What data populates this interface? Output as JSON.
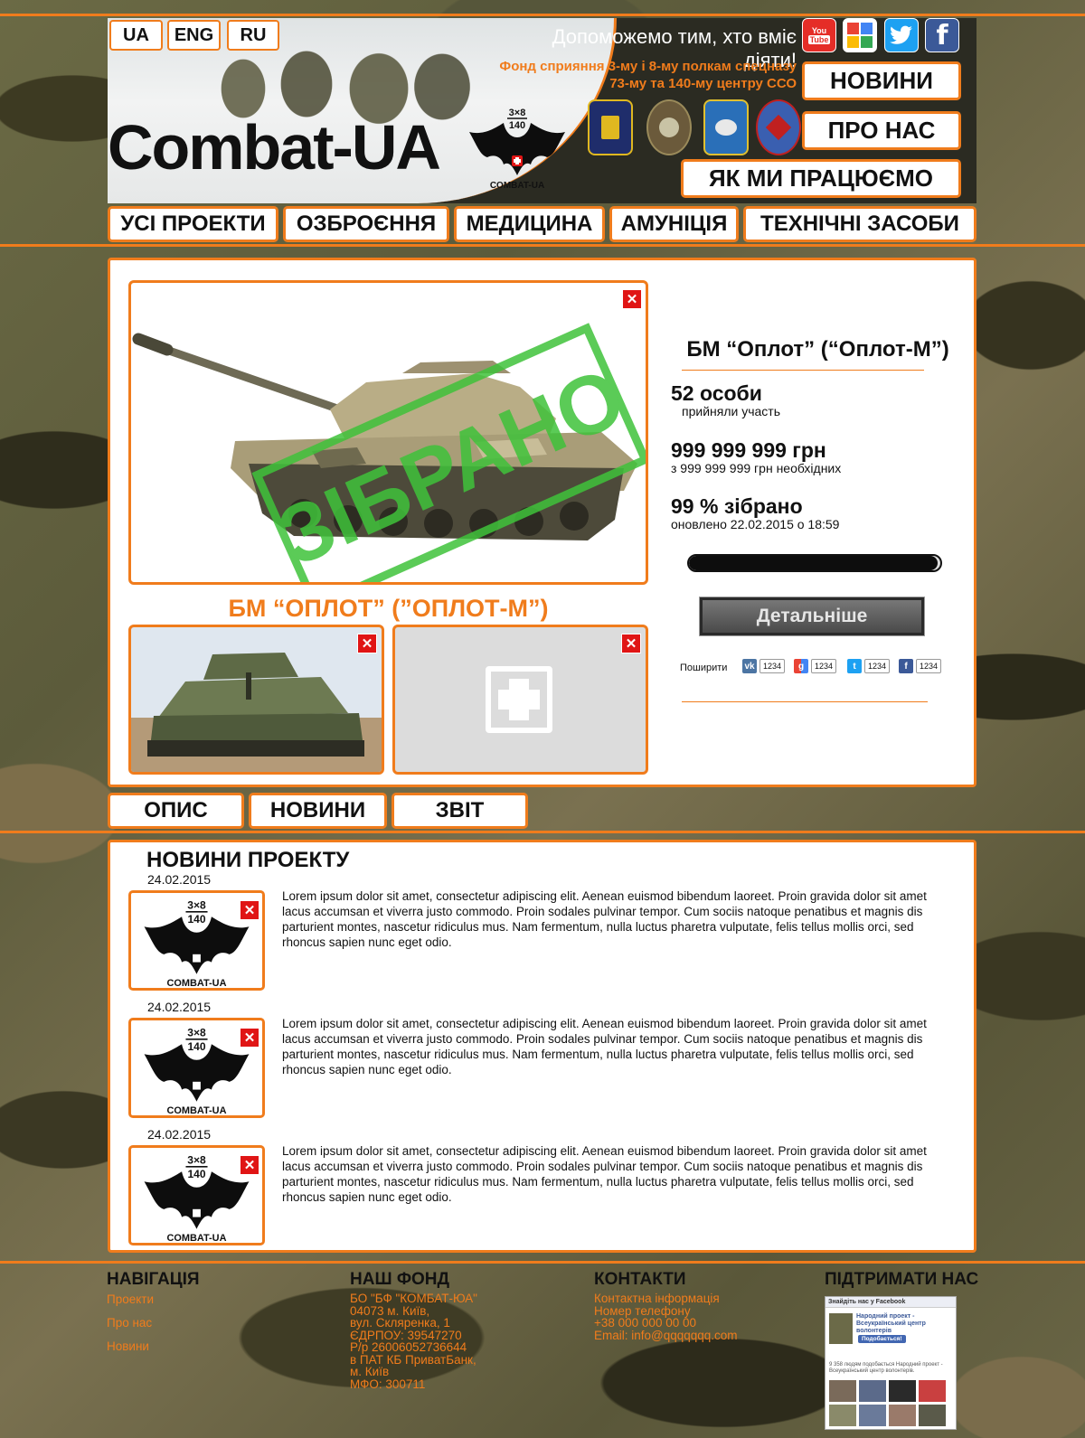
{
  "header": {
    "languages": [
      "UA",
      "ENG",
      "RU"
    ],
    "logo": "Combat-UA",
    "slogan": "Допоможемо тим, хто вміє діяти!",
    "fund_note_1": "Фонд сприяння 3-му і 8-му полкам спецназу",
    "fund_note_2": "73-му та 140-му центру ССО",
    "social": [
      "YouTube",
      "Google",
      "Twitter",
      "Facebook"
    ],
    "buttons": {
      "news": "НОВИНИ",
      "about": "ПРО НАС",
      "how": "ЯК МИ ПРАЦЮЄМО"
    }
  },
  "categories": [
    "УСІ ПРОЕКТИ",
    "ОЗБРОЄННЯ",
    "МЕДИЦИНА",
    "АМУНІЦІЯ",
    "ТЕХНІЧНІ ЗАСОБИ"
  ],
  "project": {
    "stamp": "ЗІБРАНО",
    "title_caps": "БМ “ОПЛОТ” (”ОПЛОТ-М”)",
    "title": "БМ “Оплот” (“Оплот-М”)",
    "participants": "52 особи",
    "participants_note": "прийняли участь",
    "collected": "999 999 999 грн",
    "collected_note": "з 999 999 999 грн необхідних",
    "percent_text": "99 % зібрано",
    "progress": 0.99,
    "updated": "оновлено 22.02.2015 о 18:59",
    "more_button": "Детальніше",
    "share_label": "Поширити",
    "share_counts": [
      "1234",
      "1234",
      "1234",
      "1234"
    ]
  },
  "tabs": [
    "ОПИС",
    "НОВИНИ",
    "ЗВІТ"
  ],
  "news": {
    "heading": "НОВИНИ ПРОЕКТУ",
    "items": [
      {
        "date": "24.02.2015",
        "text": "Lorem ipsum dolor sit amet, consectetur adipiscing elit. Aenean euismod bibendum laoreet. Proin gravida dolor sit amet lacus accumsan et viverra justo commodo. Proin sodales pulvinar tempor. Cum sociis natoque penatibus et magnis dis parturient montes, nascetur ridiculus mus. Nam fermentum, nulla luctus pharetra vulputate, felis tellus mollis orci, sed rhoncus sapien nunc eget odio."
      },
      {
        "date": "24.02.2015",
        "text": "Lorem ipsum dolor sit amet, consectetur adipiscing elit. Aenean euismod bibendum laoreet. Proin gravida dolor sit amet lacus accumsan et viverra justo commodo. Proin sodales pulvinar tempor. Cum sociis natoque penatibus et magnis dis parturient montes, nascetur ridiculus mus. Nam fermentum, nulla luctus pharetra vulputate, felis tellus mollis orci, sed rhoncus sapien nunc eget odio."
      },
      {
        "date": "24.02.2015",
        "text": "Lorem ipsum dolor sit amet, consectetur adipiscing elit. Aenean euismod bibendum laoreet. Proin gravida dolor sit amet lacus accumsan et viverra justo commodo. Proin sodales pulvinar tempor. Cum sociis natoque penatibus et magnis dis parturient montes, nascetur ridiculus mus. Nam fermentum, nulla luctus pharetra vulputate, felis tellus mollis orci, sed rhoncus sapien nunc eget odio."
      }
    ]
  },
  "footer": {
    "nav_heading": "НАВІГАЦІЯ",
    "nav_links": [
      "Проекти",
      "Про нас",
      "Новини"
    ],
    "fund_heading": "НАШ ФОНД",
    "fund_text": "БО \"БФ \"КОМБАТ-ЮА\"\n04073 м. Київ,\nвул. Скляренка, 1\nЄДРПОУ: 39547270\nР/р 26006052736644\nв ПАТ КБ ПриватБанк,\nм. Київ\nМФО: 300711",
    "contacts_heading": "КОНТАКТИ",
    "contacts_text": "Контактна інформація\nНомер телефону\n+38 000 000 00 00\nEmail: info@qqqqqqq.com",
    "support_heading": "ПІДТРИМАТИ НАС",
    "fb_widget": {
      "header": "Знайдіть нас у Facebook",
      "page_name": "Народний проект - Всеукраїнський центр волонтерів",
      "like_button": "Подобається!",
      "likes_text": "9 358 людям подобається Народний проект - Всеукраїнський центр волонтерів."
    }
  },
  "colors": {
    "accent": "#f07c1c",
    "stamp_green": "#3fc23a",
    "close_red": "#e01515"
  }
}
